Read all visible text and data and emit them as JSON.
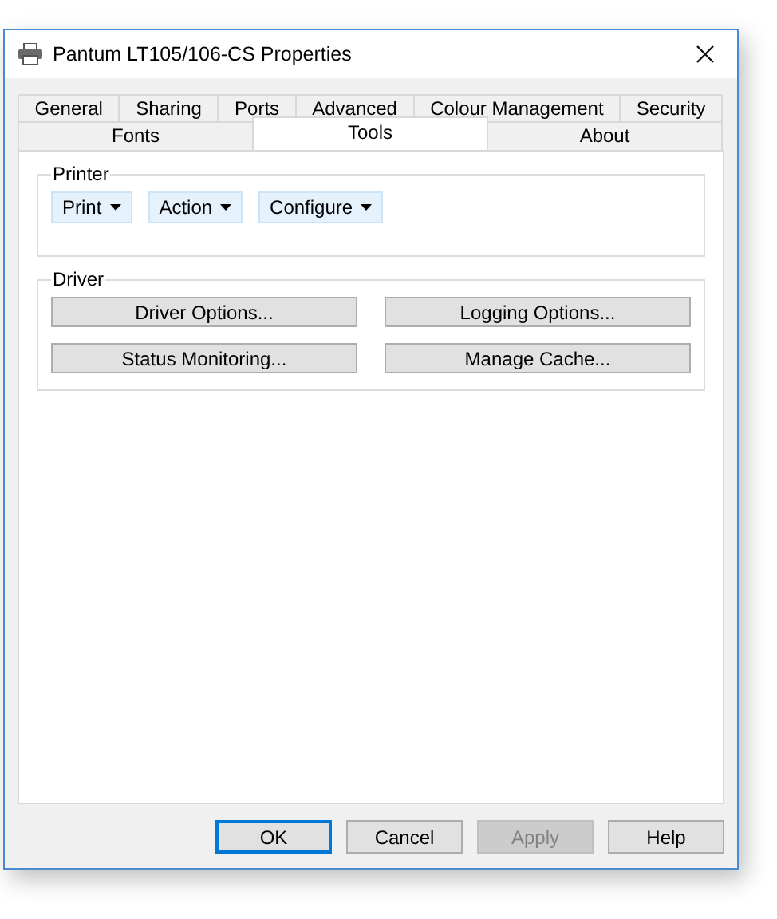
{
  "window": {
    "title": "Pantum LT105/106-CS Properties"
  },
  "tab_rows": [
    [
      {
        "label": "General",
        "selected": false
      },
      {
        "label": "Sharing",
        "selected": false
      },
      {
        "label": "Ports",
        "selected": false
      },
      {
        "label": "Advanced",
        "selected": false
      },
      {
        "label": "Colour Management",
        "selected": false
      },
      {
        "label": "Security",
        "selected": false
      }
    ],
    [
      {
        "label": "Fonts",
        "selected": false
      },
      {
        "label": "Tools",
        "selected": true
      },
      {
        "label": "About",
        "selected": false
      }
    ]
  ],
  "printer_group": {
    "title": "Printer",
    "menus": [
      "Print",
      "Action",
      "Configure"
    ]
  },
  "driver_group": {
    "title": "Driver",
    "buttons": [
      "Driver Options...",
      "Logging Options...",
      "Status Monitoring...",
      "Manage Cache..."
    ]
  },
  "footer_buttons": [
    {
      "label": "OK",
      "kind": "default",
      "disabled": false
    },
    {
      "label": "Cancel",
      "kind": "normal",
      "disabled": false
    },
    {
      "label": "Apply",
      "kind": "normal",
      "disabled": true
    },
    {
      "label": "Help",
      "kind": "normal",
      "disabled": false
    }
  ]
}
